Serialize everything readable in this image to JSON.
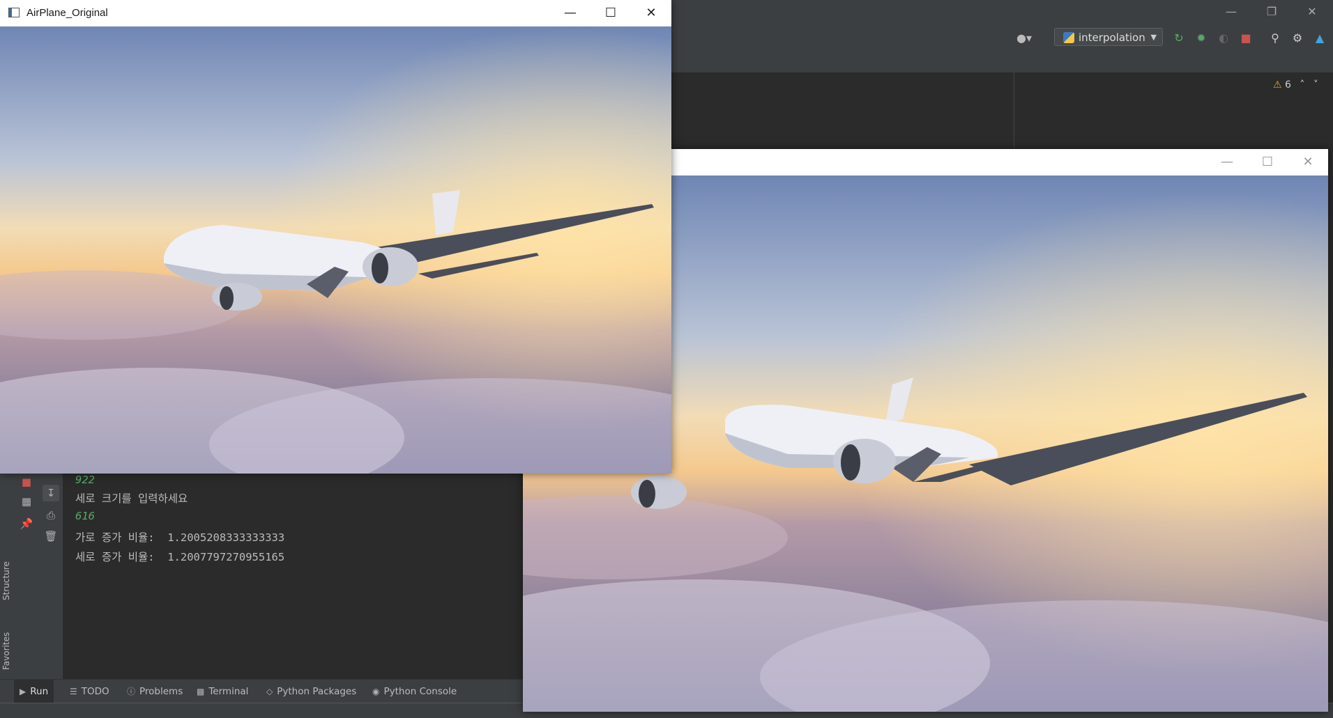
{
  "original_window": {
    "title": "AirPlane_Original"
  },
  "ide": {
    "run_config": "interpolation",
    "warning_count": "6"
  },
  "console": {
    "lines": [
      {
        "text": "922",
        "type": "input"
      },
      {
        "text": "세로 크기를 입력하세요",
        "type": "output"
      },
      {
        "text": "616",
        "type": "input"
      },
      {
        "text": "가로 증가 비율:  1.2005208333333333",
        "type": "output"
      },
      {
        "text": "세로 증가 비율:  1.2007797270955165",
        "type": "output"
      }
    ]
  },
  "side_tabs": {
    "structure": "Structure",
    "favorites": "Favorites"
  },
  "bottom_tabs": [
    {
      "label": "Run",
      "icon": "play-icon",
      "active": true
    },
    {
      "label": "TODO",
      "icon": "list-icon",
      "active": false
    },
    {
      "label": "Problems",
      "icon": "info-icon",
      "active": false
    },
    {
      "label": "Terminal",
      "icon": "terminal-icon",
      "active": false
    },
    {
      "label": "Python Packages",
      "icon": "layers-icon",
      "active": false
    },
    {
      "label": "Python Console",
      "icon": "python-icon",
      "active": false
    }
  ],
  "colors": {
    "ide_bg": "#2b2b2b",
    "ide_panel": "#3c3f41",
    "console_input": "#59a869",
    "console_text": "#bbbbbb"
  }
}
